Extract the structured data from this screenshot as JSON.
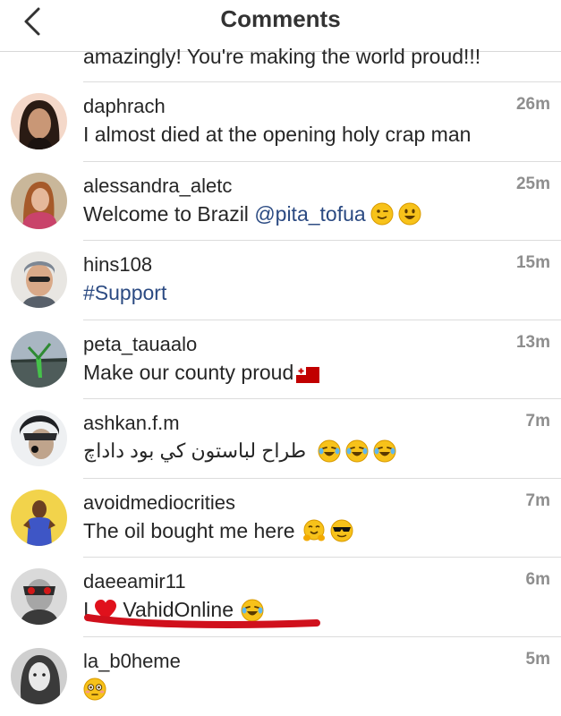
{
  "header": {
    "title": "Comments"
  },
  "partial_comment": {
    "text": "amazingly! You're making the world proud!!!"
  },
  "comments": [
    {
      "username": "daphrach",
      "time": "26m",
      "text": "I almost died at the opening holy crap man"
    },
    {
      "username": "alessandra_aletc",
      "time": "25m",
      "text": "Welcome to Brazil ",
      "mention": "@pita_tofua",
      "emojis": [
        "wink-emoji",
        "smile-emoji"
      ]
    },
    {
      "username": "hins108",
      "time": "15m",
      "hashtag": "#Support"
    },
    {
      "username": "peta_tauaalo",
      "time": "13m",
      "text": "Make our county proud",
      "emojis": [
        "tonga-flag-emoji"
      ]
    },
    {
      "username": "ashkan.f.m",
      "time": "7m",
      "text": "طراح لباستون کي بود داداچ",
      "emojis": [
        "laughing-tears-emoji",
        "laughing-tears-emoji",
        "laughing-tears-emoji"
      ]
    },
    {
      "username": "avoidmediocrities",
      "time": "7m",
      "text": "The oil bought me here",
      "emojis": [
        "hugging-emoji",
        "sunglasses-emoji"
      ]
    },
    {
      "username": "daeeamir11",
      "time": "6m",
      "text_prefix": "I",
      "text": "VahidOnline",
      "emojis": [
        "heart-emoji",
        "laughing-tears-emoji"
      ]
    },
    {
      "username": "la_b0heme",
      "time": "5m",
      "emojis": [
        "flushed-emoji"
      ]
    }
  ],
  "colors": {
    "link": "#2b4a82",
    "time": "#8e8e8e",
    "divider": "#dcdcdc",
    "annotation": "#d0101c",
    "emoji": "#f7c21a"
  }
}
